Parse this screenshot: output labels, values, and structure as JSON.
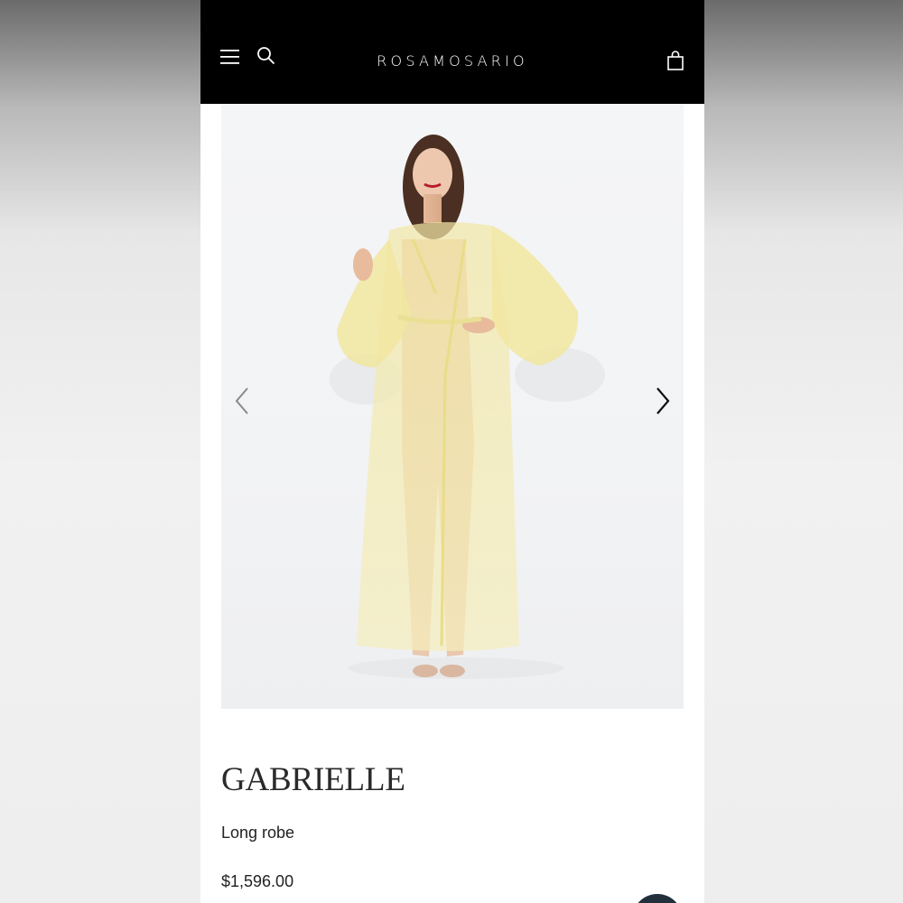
{
  "header": {
    "brand": "ROSAMOSARIO",
    "icons": [
      "menu-icon",
      "search-icon",
      "shopping-bag-icon"
    ],
    "background": "#000000"
  },
  "gallery": {
    "image_description_icon": "product-photo",
    "nav_icons": [
      "chevron-left-icon",
      "chevron-right-icon"
    ]
  },
  "product": {
    "name": "GABRIELLE",
    "type": "Long robe",
    "price": "$1,596.00"
  },
  "colors": {
    "robe": "#f3ecb0",
    "page_background": "#ffffff",
    "text": "#222222"
  }
}
